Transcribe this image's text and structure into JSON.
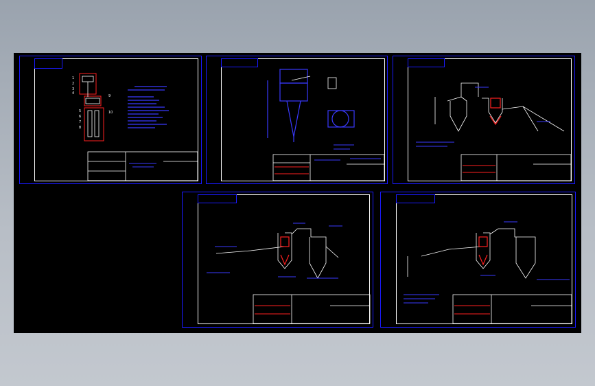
{
  "viewer": {
    "background_color": "#000000",
    "frame_color": "#1a1aff",
    "sheet_border_color": "#ffffff",
    "callout_color": "#3a3aff",
    "highlight_color": "#ff2020"
  },
  "sheets": [
    {
      "name": "sheet-1-schematic",
      "content": "schematic with numbered parts list"
    },
    {
      "name": "sheet-2-cyclone-elevation",
      "content": "cyclone separator elevation and plan"
    },
    {
      "name": "sheet-3-flow-diagram",
      "content": "process flow with hopper and cyclone"
    },
    {
      "name": "sheet-4-flow-diagram",
      "content": "process flow with cyclone and settling tank"
    },
    {
      "name": "sheet-5-flow-diagram",
      "content": "process flow with fan, cyclone and tank"
    }
  ],
  "part_numbers": [
    "1",
    "2",
    "3",
    "4",
    "5",
    "6",
    "7",
    "8",
    "9",
    "10"
  ]
}
